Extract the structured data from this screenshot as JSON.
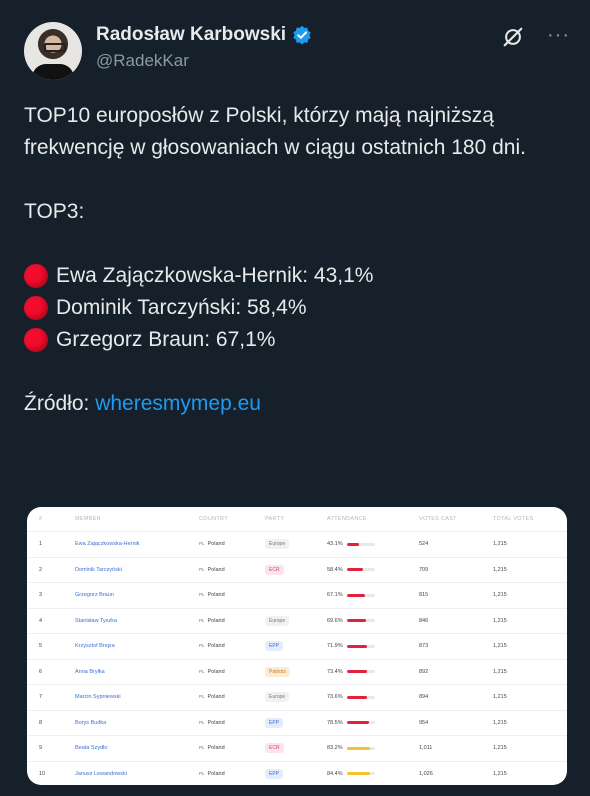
{
  "author": {
    "display_name": "Radosław Karbowski",
    "handle": "@RadekKar",
    "verified_color": "#1d9bf0"
  },
  "icons": {
    "grok": "grok-icon",
    "more": "more-icon",
    "more_glyph": "···"
  },
  "tweet": {
    "line1": "TOP10 europosłów z Polski, którzy mają najniższą frekwencję w głosowaniach w ciągu ostatnich 180 dni.",
    "top3_title": "TOP3:",
    "top3": [
      {
        "text": "Ewa Zajączkowska-Hernik: 43,1%"
      },
      {
        "text": "Dominik Tarczyński: 58,4%"
      },
      {
        "text": "Grzegorz Braun: 67,1%"
      }
    ],
    "source_label": "Źródło: ",
    "source_link": "wheresmymep.eu"
  },
  "table": {
    "headers": [
      "#",
      "MEMBER",
      "COUNTRY",
      "PARTY",
      "ATTENDANCE",
      "VOTES CAST",
      "TOTAL VOTES"
    ],
    "rows": [
      {
        "rank": "1",
        "member": "Ewa Zajączkowska-Hernik",
        "country": "Poland",
        "party": "Europe",
        "attendance": "43.1%",
        "att_value": 0.431,
        "votes_cast": "524",
        "total": "1,215"
      },
      {
        "rank": "2",
        "member": "Dominik Tarczyński",
        "country": "Poland",
        "party": "ECR",
        "attendance": "58.4%",
        "att_value": 0.584,
        "votes_cast": "709",
        "total": "1,215"
      },
      {
        "rank": "3",
        "member": "Grzegorz Braun",
        "country": "Poland",
        "party": "",
        "attendance": "67.1%",
        "att_value": 0.671,
        "votes_cast": "815",
        "total": "1,215"
      },
      {
        "rank": "4",
        "member": "Stanisław Tyszka",
        "country": "Poland",
        "party": "Europe",
        "attendance": "69.6%",
        "att_value": 0.696,
        "votes_cast": "846",
        "total": "1,215"
      },
      {
        "rank": "5",
        "member": "Krzysztof Brejza",
        "country": "Poland",
        "party": "EPP",
        "attendance": "71.9%",
        "att_value": 0.719,
        "votes_cast": "873",
        "total": "1,215"
      },
      {
        "rank": "6",
        "member": "Anna Bryłka",
        "country": "Poland",
        "party": "Patriots",
        "attendance": "73.4%",
        "att_value": 0.734,
        "votes_cast": "892",
        "total": "1,215"
      },
      {
        "rank": "7",
        "member": "Marcin Sypniewski",
        "country": "Poland",
        "party": "Europe",
        "attendance": "73.6%",
        "att_value": 0.736,
        "votes_cast": "894",
        "total": "1,215"
      },
      {
        "rank": "8",
        "member": "Borys Budka",
        "country": "Poland",
        "party": "EPP",
        "attendance": "78.5%",
        "att_value": 0.785,
        "votes_cast": "954",
        "total": "1,215"
      },
      {
        "rank": "9",
        "member": "Beata Szydło",
        "country": "Poland",
        "party": "ECR",
        "attendance": "83.2%",
        "att_value": 0.832,
        "votes_cast": "1,011",
        "total": "1,215"
      },
      {
        "rank": "10",
        "member": "Janusz Lewandowski",
        "country": "Poland",
        "party": "EPP",
        "attendance": "84.4%",
        "att_value": 0.844,
        "votes_cast": "1,026",
        "total": "1,215"
      }
    ],
    "country_flag": "PL",
    "party_colors": {
      "Europe": {
        "bg": "#f1f1f1",
        "fg": "#777777"
      },
      "ECR": {
        "bg": "#fde3ea",
        "fg": "#d24a73"
      },
      "EPP": {
        "bg": "#e3ecfb",
        "fg": "#3b6fd4"
      },
      "Patriots": {
        "bg": "#fdebd2",
        "fg": "#c07a1c"
      }
    },
    "bar_colors": {
      "low": "#e3213c",
      "mid": "#f2c230"
    }
  }
}
